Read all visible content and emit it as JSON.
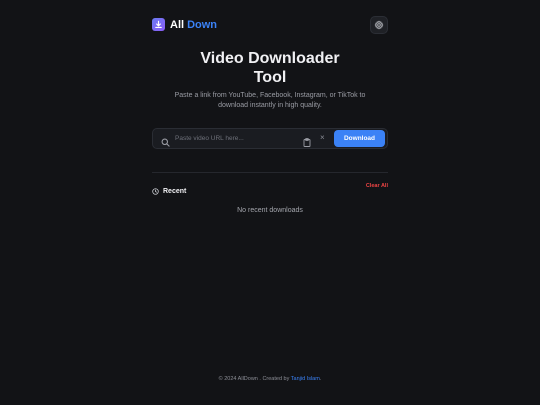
{
  "header": {
    "brand_first": "All",
    "brand_second": "Down",
    "logo_icon": "download-icon",
    "settings_icon": "gear-icon"
  },
  "hero": {
    "title_line1": "Video Downloader",
    "title_line2": "Tool",
    "subtitle_line1": "Paste a link from YouTube, Facebook, Instagram, or TikTok to",
    "subtitle_line2": "download instantly in high quality."
  },
  "url_bar": {
    "placeholder": "Paste video URL here...",
    "value": "",
    "search_icon": "search-icon",
    "paste_icon": "clipboard-icon",
    "clear_label": "×",
    "download_label": "Download"
  },
  "recent": {
    "icon": "clock-icon",
    "title": "Recent",
    "clear_label": "Clear All",
    "empty_text": "No recent downloads"
  },
  "footer": {
    "prefix": "© 2024 AllDown . Created by",
    "author": "Tanjid Islam",
    "suffix": "."
  },
  "colors": {
    "background": "#121316",
    "accent": "#3b82f6",
    "danger": "#ef4444",
    "logo_gradient": [
      "#6b7bf2",
      "#8b5cf6"
    ]
  }
}
